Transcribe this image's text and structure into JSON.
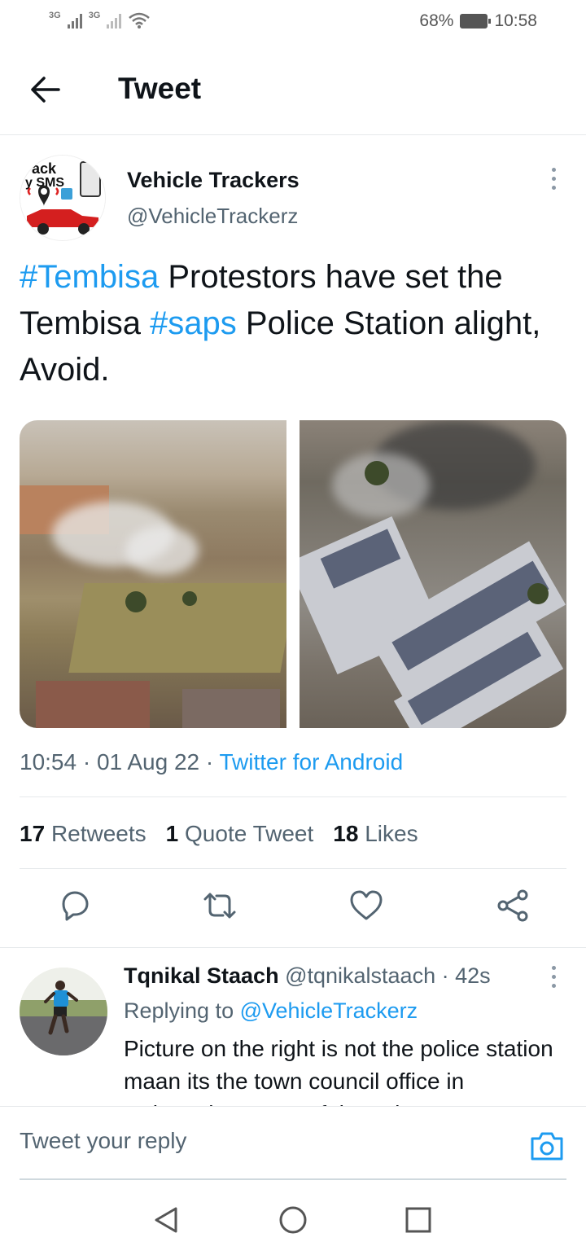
{
  "status_bar": {
    "signal_1": "3G",
    "signal_2": "3G",
    "battery_percent": "68%",
    "time": "10:58"
  },
  "header": {
    "title": "Tweet"
  },
  "tweet": {
    "author_name": "Vehicle Trackers",
    "author_handle": "@VehicleTrackerz",
    "avatar_text_1": "ack",
    "avatar_text_2": "y SMS",
    "text_parts": {
      "hashtag_1": "#Tembisa",
      "text_1": " Protestors have set the Tembisa ",
      "hashtag_2": "#saps",
      "text_2": " Police Station alight, Avoid."
    },
    "time": "10:54",
    "date": "01 Aug 22",
    "source": "Twitter for Android",
    "stats": {
      "retweets_count": "17",
      "retweets_label": "Retweets",
      "quotes_count": "1",
      "quotes_label": "Quote Tweet",
      "likes_count": "18",
      "likes_label": "Likes"
    }
  },
  "reply": {
    "author_name": "Tqnikal Staach",
    "author_handle": "@tqnikalstaach",
    "age": "42s",
    "replying_prefix": "Replying to",
    "replying_to": "@VehicleTrackerz",
    "text": "Picture on the right is not the police station maan its the town council office in Rabasotho. None of those houses"
  },
  "composer": {
    "placeholder": "Tweet your reply"
  },
  "colors": {
    "accent": "#1d9bf0",
    "text": "#0f1419",
    "secondary": "#536471"
  }
}
